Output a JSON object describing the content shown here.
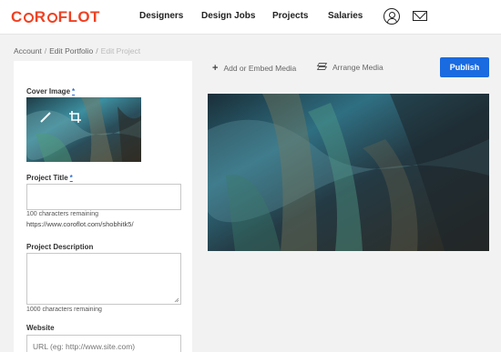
{
  "header": {
    "logo": [
      "C",
      "R",
      "FLOT"
    ],
    "nav": [
      "Designers",
      "Design Jobs",
      "Projects",
      "Salaries"
    ]
  },
  "breadcrumb": [
    "Account",
    "Edit Portfolio",
    "Edit Project"
  ],
  "form": {
    "cover_label": "Cover Image",
    "required_mark": "*",
    "title_label": "Project Title",
    "title_value": "",
    "title_hint": "100 characters remaining",
    "project_url": "https://www.coroflot.com/shobhitk5/",
    "description_label": "Project Description",
    "description_value": "",
    "description_hint": "1000 characters remaining",
    "website_label": "Website",
    "website_placeholder": "URL (eg: http://www.site.com)"
  },
  "toolbar": {
    "add_media": "Add or Embed Media",
    "arrange_media": "Arrange Media",
    "publish": "Publish"
  },
  "colors": {
    "brand": "#ef4123",
    "publish": "#1a6ae0"
  }
}
